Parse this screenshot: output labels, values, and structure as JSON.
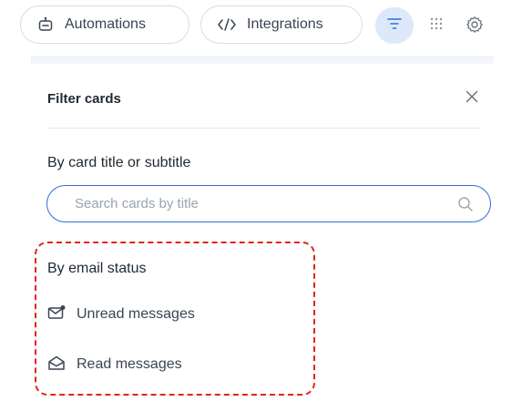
{
  "toolbar": {
    "automations_label": "Automations",
    "integrations_label": "Integrations",
    "icons": {
      "automations": "robot-icon",
      "integrations": "code-icon",
      "filter": "filter-icon",
      "grid": "grid-dots-icon",
      "settings": "gear-icon"
    },
    "active_filter_color": "#dde9fb"
  },
  "filter_panel": {
    "title": "Filter cards",
    "close_icon": "close-icon",
    "title_section": {
      "label": "By card title or subtitle",
      "search_placeholder": "Search cards by title",
      "search_value": ""
    },
    "email_section": {
      "label": "By email status",
      "options": [
        {
          "label": "Unread messages",
          "icon": "unread-mail-icon"
        },
        {
          "label": "Read messages",
          "icon": "read-mail-icon"
        }
      ]
    }
  },
  "colors": {
    "accent": "#2f6fd6",
    "highlight": "#e0231c"
  }
}
